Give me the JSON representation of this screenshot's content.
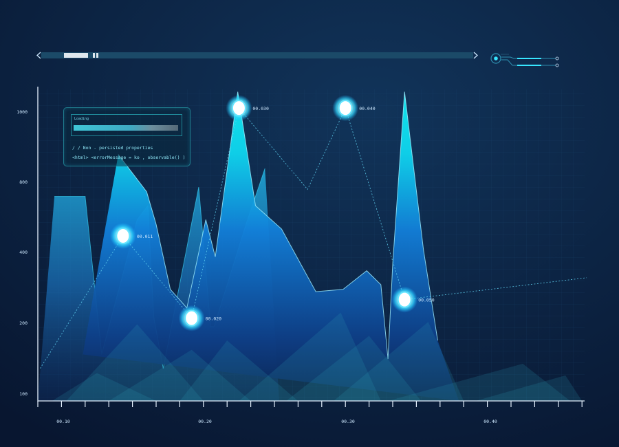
{
  "chart_data": {
    "type": "area",
    "y_ticks": [
      "1000",
      "800",
      "400",
      "200",
      "100"
    ],
    "x_ticks": [
      "00.10",
      "00.20",
      "00.30",
      "00.40"
    ],
    "series": [
      {
        "values": [
          [
            0.0,
            0
          ],
          [
            0.7,
            440
          ],
          [
            2.0,
            440
          ],
          [
            2.7,
            100
          ],
          [
            4.2,
            390
          ],
          [
            4.65,
            420
          ],
          [
            4.9,
            180
          ],
          [
            5.3,
            70
          ],
          [
            6.8,
            460
          ],
          [
            7.3,
            160
          ],
          [
            7.45,
            160
          ],
          [
            8.8,
            380
          ],
          [
            9.6,
            500
          ],
          [
            10.2,
            0
          ]
        ]
      },
      {
        "values": [
          [
            1.9,
            100
          ],
          [
            3.4,
            530
          ],
          [
            4.6,
            450
          ],
          [
            5.0,
            380
          ],
          [
            5.6,
            240
          ],
          [
            6.3,
            200
          ],
          [
            7.1,
            390
          ],
          [
            7.5,
            310
          ],
          [
            8.45,
            665
          ],
          [
            9.2,
            420
          ],
          [
            10.3,
            370
          ],
          [
            11.75,
            235
          ],
          [
            12.9,
            240
          ],
          [
            13.9,
            280
          ],
          [
            14.5,
            250
          ],
          [
            14.8,
            90
          ],
          [
            15.0,
            295
          ],
          [
            15.5,
            665
          ],
          [
            16.3,
            325
          ],
          [
            16.9,
            130
          ],
          [
            17.8,
            0
          ]
        ]
      }
    ],
    "markers": [
      {
        "label": "00.011",
        "x": 3.6,
        "y": 355
      },
      {
        "label": "00.020",
        "x": 6.5,
        "y": 178
      },
      {
        "label": "00.030",
        "x": 8.5,
        "y": 630
      },
      {
        "label": "00.040",
        "x": 13.0,
        "y": 630
      },
      {
        "label": "00.050",
        "x": 15.5,
        "y": 218
      }
    ]
  },
  "panel": {
    "title": "Loading",
    "line1": "/ / Non - persisted properties",
    "line2": "<html> <errorMessage = ko , observable() )"
  },
  "colors": {
    "accent": "#16e0f0",
    "background": "#0b1a35",
    "glow": "#1ff0ff"
  }
}
